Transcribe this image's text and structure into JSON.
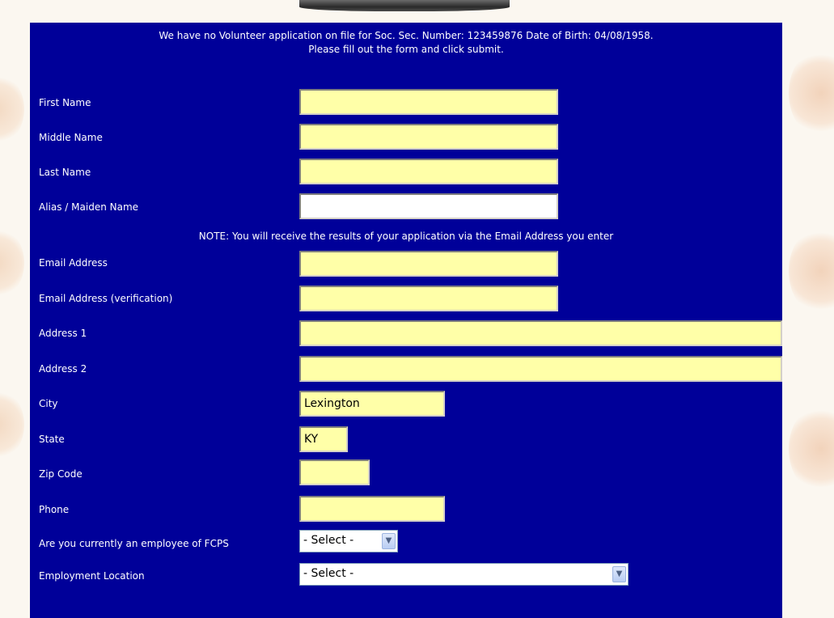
{
  "intro": {
    "line1": "We have no Volunteer application on file for Soc. Sec. Number: 123459876 Date of Birth: 04/08/1958.",
    "line2": "Please fill out the form and click submit."
  },
  "note": "NOTE: You will receive the results of your application via the Email Address you enter",
  "labels": {
    "first_name": "First Name",
    "middle_name": "Middle Name",
    "last_name": "Last Name",
    "alias": "Alias / Maiden Name",
    "email": "Email Address",
    "email_verify": "Email Address (verification)",
    "address1": "Address 1",
    "address2": "Address 2",
    "city": "City",
    "state": "State",
    "zip": "Zip Code",
    "phone": "Phone",
    "employee": "Are you currently an employee of FCPS",
    "location": "Employment Location"
  },
  "values": {
    "first_name": "",
    "middle_name": "",
    "last_name": "",
    "alias": "",
    "email": "",
    "email_verify": "",
    "address1": "",
    "address2": "",
    "city": "Lexington",
    "state": "KY",
    "zip": "",
    "phone": ""
  },
  "selects": {
    "employee": "- Select -",
    "location": "- Select -"
  },
  "colors": {
    "panel": "#000099",
    "required_field": "#ffffa8",
    "text": "#ffffff"
  }
}
